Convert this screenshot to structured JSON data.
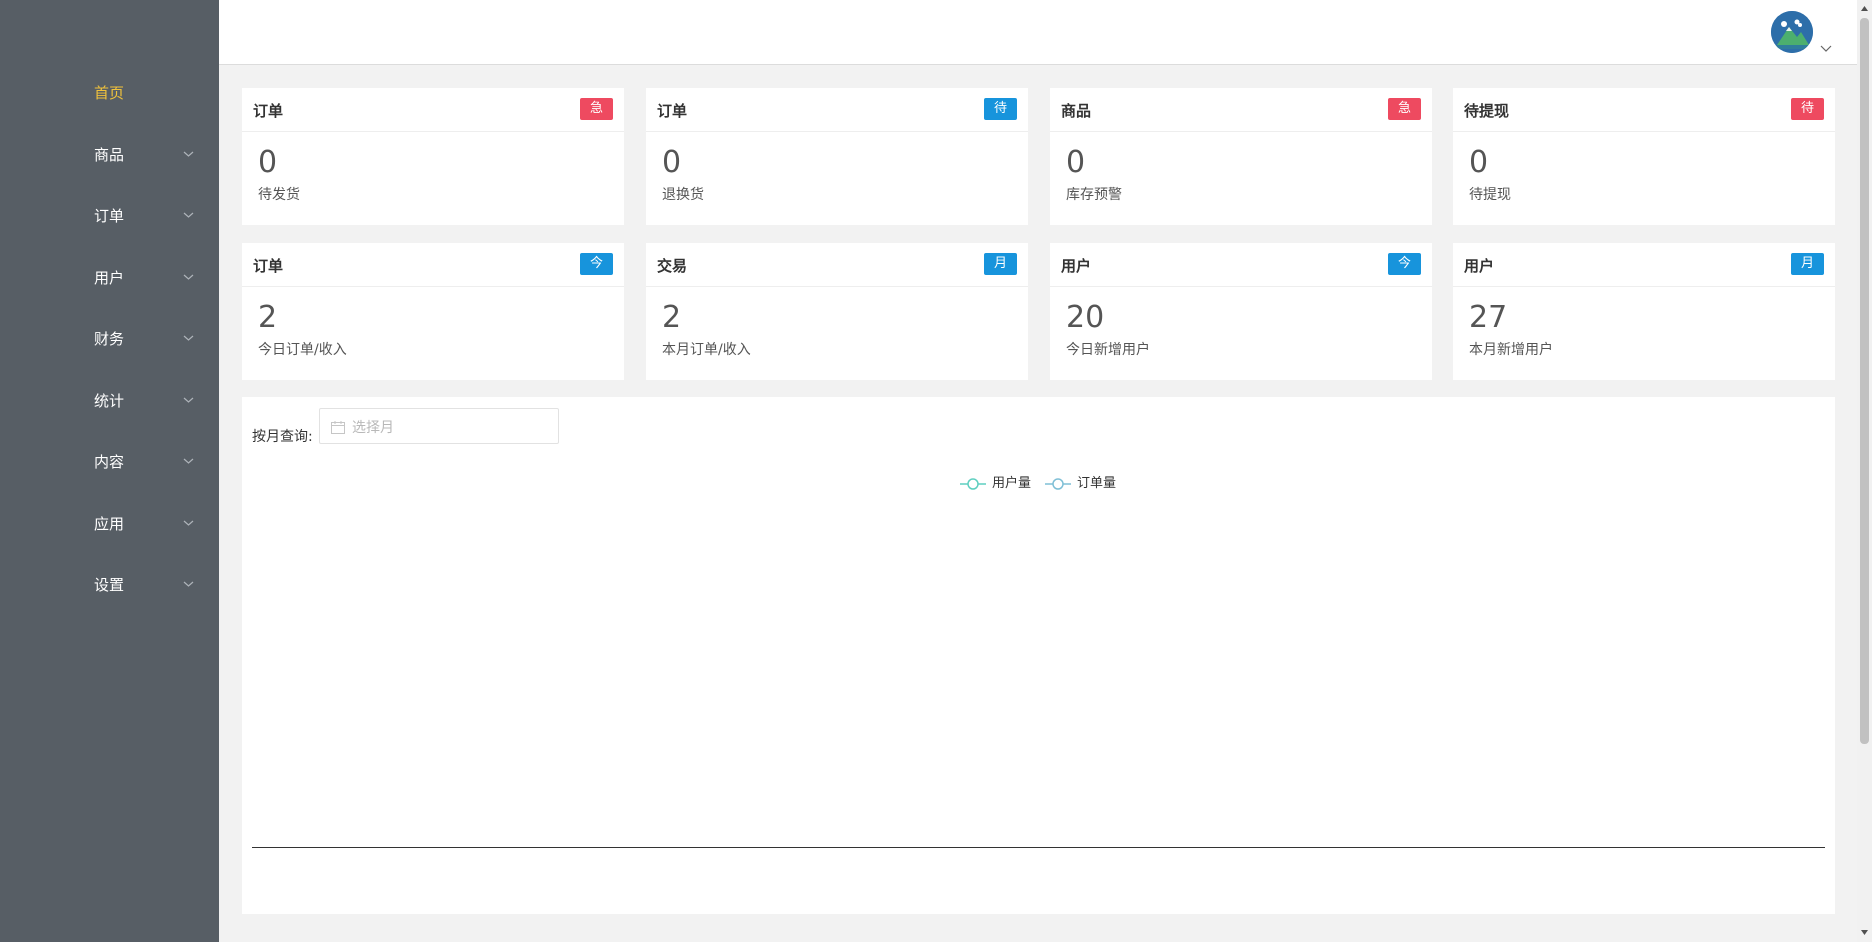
{
  "sidebar": {
    "items": [
      {
        "label": "首页",
        "active": true,
        "has_submenu": false
      },
      {
        "label": "商品",
        "active": false,
        "has_submenu": true
      },
      {
        "label": "订单",
        "active": false,
        "has_submenu": true
      },
      {
        "label": "用户",
        "active": false,
        "has_submenu": true
      },
      {
        "label": "财务",
        "active": false,
        "has_submenu": true
      },
      {
        "label": "统计",
        "active": false,
        "has_submenu": true
      },
      {
        "label": "内容",
        "active": false,
        "has_submenu": true
      },
      {
        "label": "应用",
        "active": false,
        "has_submenu": true
      },
      {
        "label": "设置",
        "active": false,
        "has_submenu": true
      }
    ],
    "background_color": "#575e65",
    "active_color": "#f0c23b",
    "chevron_icon": "chevron-down-icon"
  },
  "header": {
    "avatar_icon": "user-avatar",
    "dropdown_icon": "chevron-down-icon"
  },
  "stats": {
    "cards": [
      {
        "title": "订单",
        "badge": "急",
        "badge_color": "#ee4a60",
        "value": "0",
        "desc": "待发货"
      },
      {
        "title": "订单",
        "badge": "待",
        "badge_color": "#1794dc",
        "value": "0",
        "desc": "退换货"
      },
      {
        "title": "商品",
        "badge": "急",
        "badge_color": "#ee4a60",
        "value": "0",
        "desc": "库存预警"
      },
      {
        "title": "待提现",
        "badge": "待",
        "badge_color": "#ee4a60",
        "value": "0",
        "desc": "待提现"
      },
      {
        "title": "订单",
        "badge": "今",
        "badge_color": "#1794dc",
        "value": "2",
        "desc": "今日订单/收入"
      },
      {
        "title": "交易",
        "badge": "月",
        "badge_color": "#1794dc",
        "value": "2",
        "desc": "本月订单/收入"
      },
      {
        "title": "用户",
        "badge": "今",
        "badge_color": "#1794dc",
        "value": "20",
        "desc": "今日新增用户"
      },
      {
        "title": "用户",
        "badge": "月",
        "badge_color": "#1794dc",
        "value": "27",
        "desc": "本月新增用户"
      }
    ]
  },
  "chart_panel": {
    "query_label": "按月查询:",
    "month_placeholder": "选择月",
    "calendar_icon": "calendar-icon",
    "legend": [
      {
        "name": "用户量",
        "color": "#5fcfc0"
      },
      {
        "name": "订单量",
        "color": "#7fbfd6"
      }
    ]
  }
}
